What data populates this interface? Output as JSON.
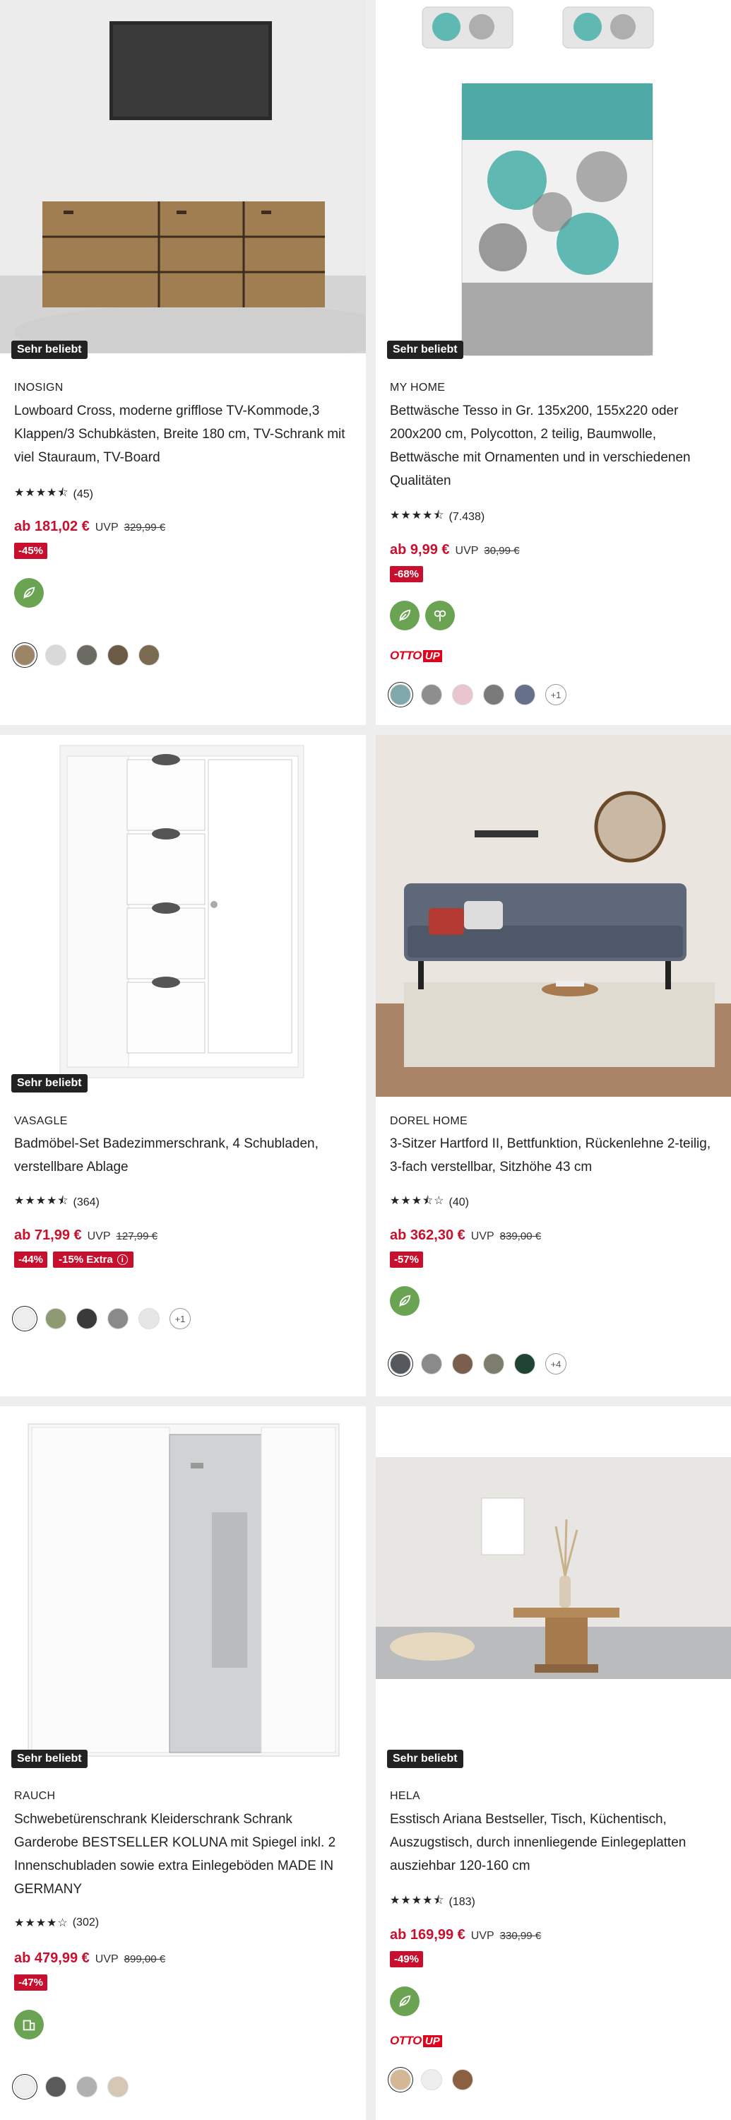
{
  "products": [
    {
      "badge": "Sehr beliebt",
      "brand": "INOSIGN",
      "title": "Lowboard Cross, moderne grifflose TV-Kommode,3 Klappen/3 Schubkästen, Breite 180 cm, TV-Schrank mit viel Stauraum, TV-Board",
      "stars": "★★★★⯪",
      "reviews": "(45)",
      "price": "ab 181,02 €",
      "uvp_label": "UVP",
      "uvp": "329,99 €",
      "discount": "-45%",
      "colors": [
        "#9c8467",
        "#d9d9d9",
        "#6b6b63",
        "#6b5a44",
        "#7a6a50"
      ]
    },
    {
      "badge": "Sehr beliebt",
      "brand": "MY HOME",
      "title": "Bettwäsche Tesso in Gr. 135x200, 155x220 oder 200x200 cm, Polycotton, 2 teilig, Baumwolle, Bettwäsche mit Ornamenten und in verschiedenen Qualitäten",
      "stars": "★★★★⯪",
      "reviews": "(7.438)",
      "price": "ab 9,99 €",
      "uvp_label": "UVP",
      "uvp": "30,99 €",
      "discount": "-68%",
      "otto_up": "OTTO",
      "otto_up_b": "UP",
      "colors": [
        "#7fa8ad",
        "#8e8e8e",
        "#e8c5cf",
        "#7a7a7a",
        "#66708a"
      ],
      "more": "+1"
    },
    {
      "badge": "Sehr beliebt",
      "brand": "VASAGLE",
      "title": "Badmöbel-Set Badezimmerschrank, 4 Schubladen, verstellbare Ablage",
      "stars": "★★★★⯪",
      "reviews": "(364)",
      "price": "ab 71,99 €",
      "uvp_label": "UVP",
      "uvp": "127,99 €",
      "discount": "-44%",
      "extra": "-15% Extra",
      "extra_icon": "ⓘ",
      "colors": [
        "#eeeeee",
        "#8e9a72",
        "#3a3a3a",
        "#8a8a8a",
        "#e6e6e6"
      ],
      "more": "+1"
    },
    {
      "brand": "DOREL HOME",
      "title": "3-Sitzer Hartford II, Bettfunktion, Rückenlehne 2-teilig, 3-fach verstellbar, Sitzhöhe 43 cm",
      "stars": "★★★⯪☆",
      "reviews": "(40)",
      "price": "ab 362,30 €",
      "uvp_label": "UVP",
      "uvp": "839,00 €",
      "discount": "-57%",
      "colors": [
        "#55595e",
        "#8a8a8a",
        "#7a5f4e",
        "#7d7d6e",
        "#1f4434"
      ],
      "more": "+4"
    },
    {
      "badge": "Sehr beliebt",
      "brand": "RAUCH",
      "title": "Schwebetürenschrank Kleiderschrank Schrank Garderobe BESTSELLER KOLUNA mit Spiegel inkl. 2 Innenschubladen sowie extra Einlegeböden MADE IN GERMANY",
      "stars": "★★★★☆",
      "reviews": "(302)",
      "price": "ab 479,99 €",
      "uvp_label": "UVP",
      "uvp": "899,00 €",
      "discount": "-47%",
      "colors": [
        "#eeeeee",
        "#5a5a5a",
        "#b0b0b0",
        "#d6c7b4"
      ]
    },
    {
      "badge": "Sehr beliebt",
      "brand": "HELA",
      "title": "Esstisch Ariana Bestseller, Tisch, Küchentisch, Auszugstisch, durch innenliegende Einlegeplatten ausziehbar 120-160 cm",
      "stars": "★★★★⯪",
      "reviews": "(183)",
      "price": "ab 169,99 €",
      "uvp_label": "UVP",
      "uvp": "330,99 €",
      "discount": "-49%",
      "otto_up": "OTTO",
      "otto_up_b": "UP",
      "colors": [
        "#d4b896",
        "#eeeeee",
        "#8a6040"
      ]
    }
  ],
  "icons": {
    "eco": "leaf-recycle-icon",
    "info": "info-icon"
  },
  "accent": "#c8102e",
  "eco_color": "#6aa352"
}
